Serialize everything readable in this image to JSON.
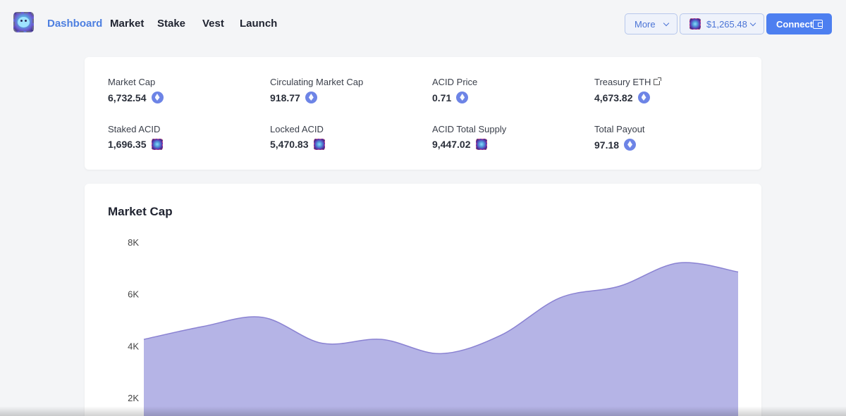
{
  "nav": {
    "links": [
      "Dashboard",
      "Market",
      "Stake",
      "Vest",
      "Launch"
    ],
    "more_label": "More",
    "price_label": "$1,265.48",
    "connect_label": "Connect"
  },
  "stats": [
    {
      "label": "Market Cap",
      "value": "6,732.54",
      "icon": "eth-icon"
    },
    {
      "label": "Circulating Market Cap",
      "value": "918.77",
      "icon": "eth-icon"
    },
    {
      "label": "ACID Price",
      "value": "0.71",
      "icon": "eth-icon"
    },
    {
      "label": "Treasury ETH",
      "value": "4,673.82",
      "icon": "eth-icon",
      "external_link": true
    },
    {
      "label": "Staked ACID",
      "value": "1,696.35",
      "icon": "acid-token-icon"
    },
    {
      "label": "Locked ACID",
      "value": "5,470.83",
      "icon": "acid-token-icon"
    },
    {
      "label": "ACID Total Supply",
      "value": "9,447.02",
      "icon": "acid-token-icon"
    },
    {
      "label": "Total Payout",
      "value": "97.18",
      "icon": "eth-icon"
    }
  ],
  "colors": {
    "accent": "#4d7ff0",
    "area_fill": "#b5b4e6",
    "area_stroke": "#8a82d2"
  },
  "chart_data": {
    "type": "area",
    "title": "Market Cap",
    "ytick_labels": [
      "8K",
      "6K",
      "4K",
      "2K"
    ],
    "yticks": [
      8000,
      6000,
      4000,
      2000
    ],
    "ylim": [
      0,
      8000
    ],
    "x": [
      0,
      1,
      2,
      3,
      4,
      5,
      6,
      7,
      8,
      9,
      10
    ],
    "values": [
      4250,
      4750,
      5100,
      4100,
      4250,
      3700,
      4400,
      5850,
      6300,
      7200,
      6850
    ],
    "grid": false
  }
}
